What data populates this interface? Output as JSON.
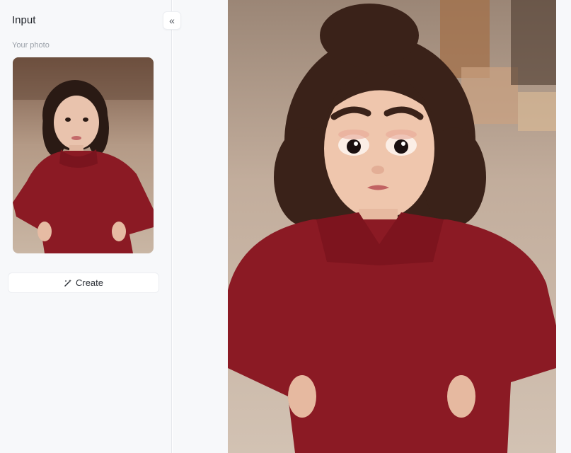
{
  "sidebar": {
    "title": "Input",
    "collapse_icon": "double-chevron-left-icon",
    "photo_label": "Your photo",
    "create_label": "Create",
    "create_icon": "magic-wand-icon"
  },
  "colors": {
    "sweater": "#8b1a24",
    "background_warm": "#c9b6a4",
    "sidebar_bg": "#f7f8fa"
  }
}
